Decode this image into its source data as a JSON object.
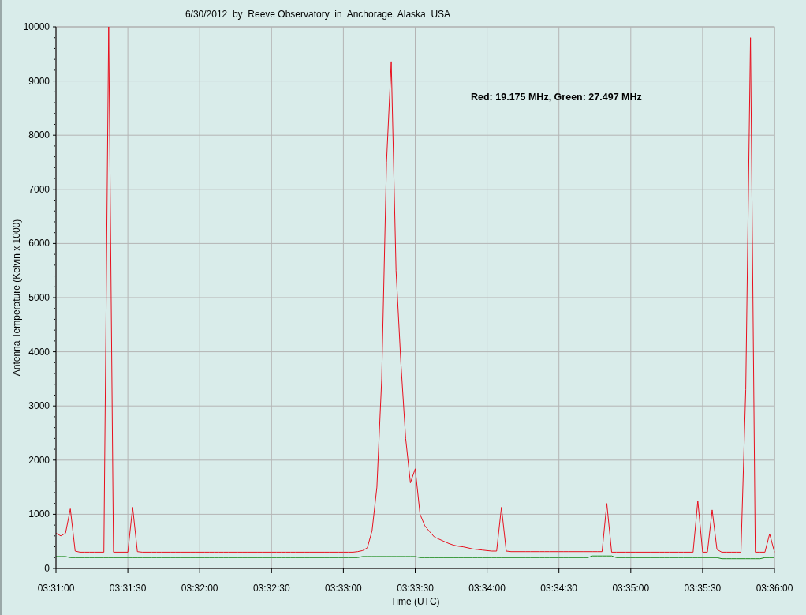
{
  "chart_data": {
    "type": "line",
    "title": "6/30/2012  by  Reeve Observatory  in  Anchorage, Alaska  USA",
    "xlabel": "Time (UTC)",
    "ylabel": "Antenna Temperature (Kelvin x 1000)",
    "grid": true,
    "categories": [
      "03:31:00",
      null,
      null,
      null,
      null,
      null,
      null,
      null,
      null,
      null,
      null,
      null,
      null,
      null,
      null,
      "03:31:30",
      null,
      null,
      null,
      null,
      null,
      null,
      null,
      null,
      null,
      null,
      null,
      null,
      null,
      null,
      "03:32:00",
      null,
      null,
      null,
      null,
      null,
      null,
      null,
      null,
      null,
      null,
      null,
      null,
      null,
      null,
      "03:32:30",
      null,
      null,
      null,
      null,
      null,
      null,
      null,
      null,
      null,
      null,
      null,
      null,
      null,
      null,
      "03:33:00",
      null,
      null,
      null,
      null,
      null,
      null,
      null,
      null,
      null,
      null,
      null,
      null,
      null,
      null,
      "03:33:30",
      null,
      null,
      null,
      null,
      null,
      null,
      null,
      null,
      null,
      null,
      null,
      null,
      null,
      null,
      "03:34:00",
      null,
      null,
      null,
      null,
      null,
      null,
      null,
      null,
      null,
      null,
      null,
      null,
      null,
      null,
      "03:34:30",
      null,
      null,
      null,
      null,
      null,
      null,
      null,
      null,
      null,
      null,
      null,
      null,
      null,
      null,
      "03:35:00",
      null,
      null,
      null,
      null,
      null,
      null,
      null,
      null,
      null,
      null,
      null,
      null,
      null,
      null,
      "03:35:30",
      null,
      null,
      null,
      null,
      null,
      null,
      null,
      null,
      null,
      null,
      null,
      null,
      null,
      null,
      "03:36:00"
    ],
    "series": [
      {
        "color": "#e8101e",
        "values": [
          650,
          600,
          650,
          1100,
          320,
          300,
          300,
          300,
          300,
          300,
          300,
          10000,
          300,
          300,
          300,
          300,
          1130,
          310,
          300,
          300,
          300,
          300,
          300,
          300,
          300,
          300,
          300,
          300,
          300,
          300,
          300,
          300,
          300,
          300,
          300,
          300,
          300,
          300,
          300,
          300,
          300,
          300,
          300,
          300,
          300,
          300,
          300,
          300,
          300,
          300,
          300,
          300,
          300,
          300,
          300,
          300,
          300,
          300,
          300,
          300,
          300,
          300,
          300,
          310,
          330,
          380,
          700,
          1500,
          3500,
          7500,
          9360,
          5500,
          3800,
          2400,
          1580,
          1840,
          1000,
          790,
          680,
          580,
          540,
          500,
          460,
          430,
          410,
          400,
          380,
          360,
          350,
          340,
          330,
          320,
          320,
          1130,
          320,
          310,
          310,
          310,
          310,
          310,
          310,
          310,
          310,
          310,
          310,
          310,
          310,
          310,
          310,
          310,
          310,
          310,
          310,
          310,
          310,
          1200,
          300,
          300,
          300,
          300,
          300,
          300,
          300,
          300,
          300,
          300,
          300,
          300,
          300,
          300,
          300,
          300,
          300,
          300,
          1250,
          300,
          300,
          1080,
          350,
          300,
          300,
          300,
          300,
          300,
          3300,
          9800,
          300,
          300,
          300,
          640,
          300
        ]
      },
      {
        "color": "#1a8a1a",
        "values": [
          220,
          220,
          220,
          200,
          200,
          200,
          200,
          200,
          200,
          200,
          200,
          200,
          200,
          200,
          200,
          200,
          200,
          200,
          200,
          200,
          200,
          200,
          200,
          200,
          200,
          200,
          200,
          200,
          200,
          200,
          200,
          200,
          200,
          200,
          200,
          200,
          200,
          200,
          200,
          200,
          200,
          200,
          200,
          200,
          200,
          200,
          200,
          200,
          200,
          200,
          200,
          200,
          200,
          200,
          200,
          200,
          200,
          200,
          200,
          200,
          200,
          200,
          200,
          200,
          220,
          220,
          220,
          220,
          220,
          220,
          220,
          220,
          220,
          220,
          220,
          220,
          200,
          200,
          200,
          200,
          200,
          200,
          200,
          200,
          200,
          200,
          200,
          200,
          200,
          200,
          200,
          200,
          200,
          200,
          200,
          200,
          200,
          200,
          200,
          200,
          200,
          200,
          200,
          200,
          200,
          200,
          200,
          200,
          200,
          200,
          200,
          200,
          230,
          230,
          230,
          230,
          230,
          200,
          200,
          200,
          200,
          200,
          200,
          200,
          200,
          200,
          200,
          200,
          200,
          200,
          200,
          200,
          200,
          200,
          200,
          200,
          200,
          200,
          200,
          180,
          180,
          180,
          180,
          180,
          180,
          180,
          180,
          180,
          200,
          200,
          200
        ]
      }
    ],
    "ylim": [
      0,
      10000
    ],
    "yticks": [
      0,
      1000,
      2000,
      3000,
      4000,
      5000,
      6000,
      7000,
      8000,
      9000,
      10000
    ],
    "annotations": [
      "Red: 19.175 MHz, Green: 27.497 MHz"
    ]
  }
}
